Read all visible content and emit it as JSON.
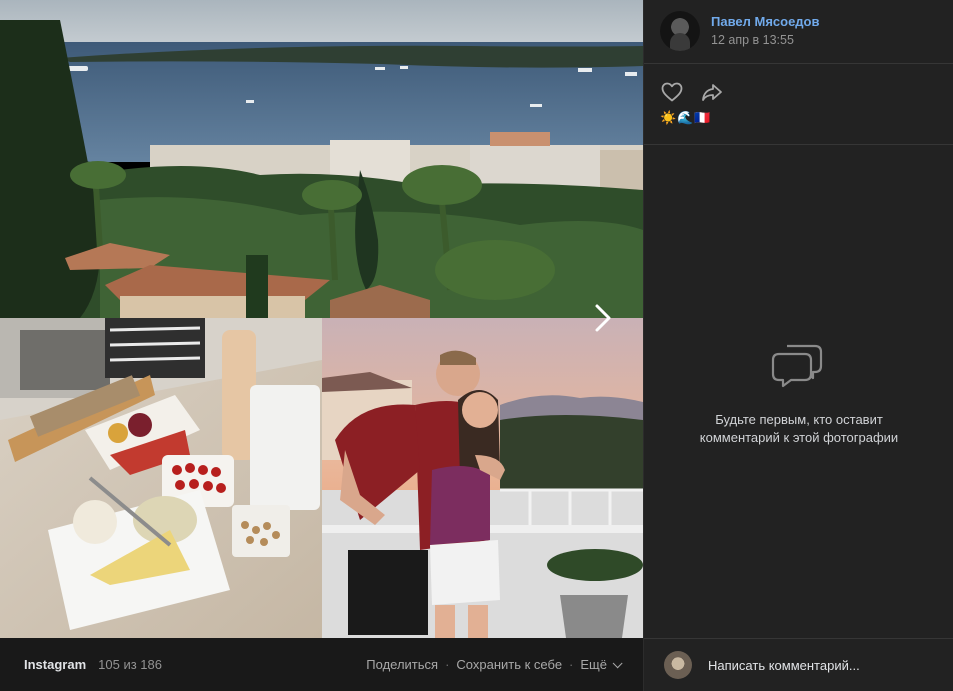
{
  "photo": {
    "alt_hint": ""
  },
  "bottom_bar": {
    "source": "Instagram",
    "counter": "105 из 186",
    "share_label": "Поделиться",
    "save_label": "Сохранить к себе",
    "more_label": "Ещё",
    "separator": "·"
  },
  "post": {
    "author_name": "Павел Мясоедов",
    "date": "12 апр в 13:55",
    "caption_emojis": "☀️🌊🇫🇷"
  },
  "comments": {
    "empty_text": "Будьте первым, кто оставит комментарий к этой фотографии",
    "input_placeholder": "Написать комментарий..."
  },
  "colors": {
    "link": "#71aaeb",
    "background": "#222222",
    "secondary_text": "#939393"
  }
}
